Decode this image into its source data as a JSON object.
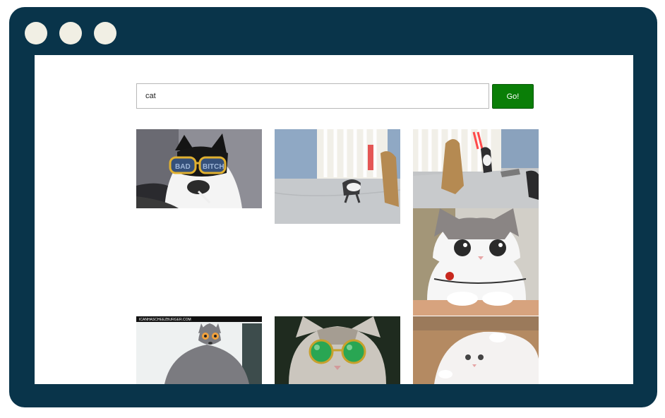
{
  "search": {
    "value": "cat",
    "button_label": "Go!"
  },
  "results": [
    {
      "name": "cat-sunglasses-smoking",
      "icon": "cat-with-sunglasses",
      "caption": "BAD BITCH",
      "colors": {
        "bg": "#8a8a90",
        "cat": "#f3f3f3",
        "dark": "#141414",
        "frame": "#e0b030"
      }
    },
    {
      "name": "kitten-laser-gate-1",
      "icon": "kitten-playing-with-laser",
      "colors": {
        "floor": "#c9ccd0",
        "wall": "#8fa8c4",
        "bars": "#f2f0ea",
        "laser": "#e23b3b"
      }
    },
    {
      "name": "kitten-laser-gate-2",
      "icon": "kittens-playing-with-laser",
      "colors": {
        "floor": "#c2c4c6",
        "wall": "#8aa2bd",
        "bars": "#f2f0ea",
        "laser": "#ff3b3b"
      }
    },
    {
      "name": "surprised-white-cat",
      "icon": "cat-wide-eyes",
      "colors": {
        "bg": "#b4a58a",
        "cat": "#f6f6f6",
        "grey": "#8a8584",
        "table": "#d7a37e"
      }
    },
    {
      "name": "grey-cat-surprised",
      "icon": "grey-cat-wide-eyes",
      "watermark": "ICANHASCHEEZBURGER.COM",
      "colors": {
        "bg": "#eef1f1",
        "cat": "#7b7b80",
        "eye": "#f2a13c"
      }
    },
    {
      "name": "cat-green-glasses",
      "icon": "cat-with-round-glasses",
      "colors": {
        "bg": "#1f2b1f",
        "cat": "#cbc6be",
        "lens": "#29a653"
      }
    },
    {
      "name": "white-kitten-lying",
      "icon": "white-kitten-rolling",
      "colors": {
        "bg": "#b48a62",
        "cat": "#f4f2f1"
      }
    }
  ]
}
